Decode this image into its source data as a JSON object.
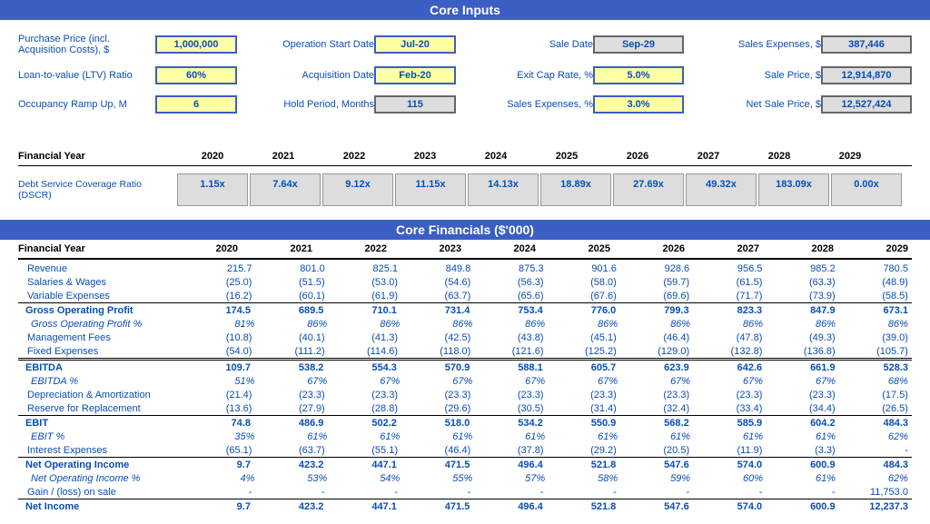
{
  "hdr1": "Core Inputs",
  "hdr2": "Core Financials ($'000)",
  "inputs": {
    "r1c1l": "Purchase Price (incl. Acquisition Costs), $",
    "r1c1v": "1,000,000",
    "r1c2l": "Operation Start Date",
    "r1c2v": "Jul-20",
    "r1c3l": "Sale Date",
    "r1c3v": "Sep-29",
    "r1c4l": "Sales Expenses, $",
    "r1c4v": "387,446",
    "r2c1l": "Loan-to-value (LTV) Ratio",
    "r2c1v": "60%",
    "r2c2l": "Acquisition Date",
    "r2c2v": "Feb-20",
    "r2c3l": "Exit Cap Rate, %",
    "r2c3v": "5.0%",
    "r2c4l": "Sale Price, $",
    "r2c4v": "12,914,870",
    "r3c1l": "Occupancy Ramp Up, M",
    "r3c1v": "6",
    "r3c2l": "Hold Period, Months",
    "r3c2v": "115",
    "r3c3l": "Sales Expenses, %",
    "r3c3v": "3.0%",
    "r3c4l": "Net Sale Price, $",
    "r3c4v": "12,527,424"
  },
  "fy_label": "Financial Year",
  "dscr_label": "Debt Service Coverage Ratio (DSCR)",
  "years": [
    "2020",
    "2021",
    "2022",
    "2023",
    "2024",
    "2025",
    "2026",
    "2027",
    "2028",
    "2029"
  ],
  "dscr": [
    "1.15x",
    "7.64x",
    "9.12x",
    "11.15x",
    "14.13x",
    "18.89x",
    "27.69x",
    "49.32x",
    "183.09x",
    "0.00x"
  ],
  "chart_data": {
    "type": "table",
    "title": "Core Financials ($'000)",
    "categories": [
      "2020",
      "2021",
      "2022",
      "2023",
      "2024",
      "2025",
      "2026",
      "2027",
      "2028",
      "2029"
    ],
    "series": [
      {
        "name": "Revenue",
        "values": [
          215.7,
          801.0,
          825.1,
          849.8,
          875.3,
          901.6,
          928.6,
          956.5,
          985.2,
          780.5
        ]
      },
      {
        "name": "Salaries & Wages",
        "values": [
          -25.0,
          -51.5,
          -53.0,
          -54.6,
          -56.3,
          -58.0,
          -59.7,
          -61.5,
          -63.3,
          -48.9
        ]
      },
      {
        "name": "Variable Expenses",
        "values": [
          -16.2,
          -60.1,
          -61.9,
          -63.7,
          -65.6,
          -67.6,
          -69.6,
          -71.7,
          -73.9,
          -58.5
        ]
      },
      {
        "name": "Gross Operating Profit",
        "values": [
          174.5,
          689.5,
          710.1,
          731.4,
          753.4,
          776.0,
          799.3,
          823.3,
          847.9,
          673.1
        ]
      },
      {
        "name": "Gross Operating Profit %",
        "values": [
          81,
          86,
          86,
          86,
          86,
          86,
          86,
          86,
          86,
          86
        ]
      },
      {
        "name": "Management Fees",
        "values": [
          -10.8,
          -40.1,
          -41.3,
          -42.5,
          -43.8,
          -45.1,
          -46.4,
          -47.8,
          -49.3,
          -39.0
        ]
      },
      {
        "name": "Fixed Expenses",
        "values": [
          -54.0,
          -111.2,
          -114.6,
          -118.0,
          -121.6,
          -125.2,
          -129.0,
          -132.8,
          -136.8,
          -105.7
        ]
      },
      {
        "name": "EBITDA",
        "values": [
          109.7,
          538.2,
          554.3,
          570.9,
          588.1,
          605.7,
          623.9,
          642.6,
          661.9,
          528.3
        ]
      },
      {
        "name": "EBITDA %",
        "values": [
          51,
          67,
          67,
          67,
          67,
          67,
          67,
          67,
          67,
          68
        ]
      },
      {
        "name": "Depreciation & Amortization",
        "values": [
          -21.4,
          -23.3,
          -23.3,
          -23.3,
          -23.3,
          -23.3,
          -23.3,
          -23.3,
          -23.3,
          -17.5
        ]
      },
      {
        "name": "Reserve for Replacement",
        "values": [
          -13.6,
          -27.9,
          -28.8,
          -29.6,
          -30.5,
          -31.4,
          -32.4,
          -33.4,
          -34.4,
          -26.5
        ]
      },
      {
        "name": "EBIT",
        "values": [
          74.8,
          486.9,
          502.2,
          518.0,
          534.2,
          550.9,
          568.2,
          585.9,
          604.2,
          484.3
        ]
      },
      {
        "name": "EBIT %",
        "values": [
          35,
          61,
          61,
          61,
          61,
          61,
          61,
          61,
          61,
          62
        ]
      },
      {
        "name": "Interest Expenses",
        "values": [
          -65.1,
          -63.7,
          -55.1,
          -46.4,
          -37.8,
          -29.2,
          -20.5,
          -11.9,
          -3.3,
          0
        ]
      },
      {
        "name": "Net Operating Income",
        "values": [
          9.7,
          423.2,
          447.1,
          471.5,
          496.4,
          521.8,
          547.6,
          574.0,
          600.9,
          484.3
        ]
      },
      {
        "name": "Net Operating Income %",
        "values": [
          4,
          53,
          54,
          55,
          57,
          58,
          59,
          60,
          61,
          62
        ]
      },
      {
        "name": "Gain / (loss) on sale",
        "values": [
          0,
          0,
          0,
          0,
          0,
          0,
          0,
          0,
          0,
          11753.0
        ]
      },
      {
        "name": "Net Income",
        "values": [
          9.7,
          423.2,
          447.1,
          471.5,
          496.4,
          521.8,
          547.6,
          574.0,
          600.9,
          12237.3
        ]
      }
    ]
  },
  "fin": {
    "revenue": {
      "l": "Revenue",
      "v": [
        "215.7",
        "801.0",
        "825.1",
        "849.8",
        "875.3",
        "901.6",
        "928.6",
        "956.5",
        "985.2",
        "780.5"
      ]
    },
    "salaries": {
      "l": "Salaries & Wages",
      "v": [
        "(25.0)",
        "(51.5)",
        "(53.0)",
        "(54.6)",
        "(56.3)",
        "(58.0)",
        "(59.7)",
        "(61.5)",
        "(63.3)",
        "(48.9)"
      ]
    },
    "varexp": {
      "l": "Variable Expenses",
      "v": [
        "(16.2)",
        "(60.1)",
        "(61.9)",
        "(63.7)",
        "(65.6)",
        "(67.6)",
        "(69.6)",
        "(71.7)",
        "(73.9)",
        "(58.5)"
      ]
    },
    "gop": {
      "l": "Gross Operating Profit",
      "v": [
        "174.5",
        "689.5",
        "710.1",
        "731.4",
        "753.4",
        "776.0",
        "799.3",
        "823.3",
        "847.9",
        "673.1"
      ]
    },
    "gopp": {
      "l": "Gross Operating Profit %",
      "v": [
        "81%",
        "86%",
        "86%",
        "86%",
        "86%",
        "86%",
        "86%",
        "86%",
        "86%",
        "86%"
      ]
    },
    "mgmt": {
      "l": "Management Fees",
      "v": [
        "(10.8)",
        "(40.1)",
        "(41.3)",
        "(42.5)",
        "(43.8)",
        "(45.1)",
        "(46.4)",
        "(47.8)",
        "(49.3)",
        "(39.0)"
      ]
    },
    "fixed": {
      "l": "Fixed Expenses",
      "v": [
        "(54.0)",
        "(111.2)",
        "(114.6)",
        "(118.0)",
        "(121.6)",
        "(125.2)",
        "(129.0)",
        "(132.8)",
        "(136.8)",
        "(105.7)"
      ]
    },
    "ebitda": {
      "l": "EBITDA",
      "v": [
        "109.7",
        "538.2",
        "554.3",
        "570.9",
        "588.1",
        "605.7",
        "623.9",
        "642.6",
        "661.9",
        "528.3"
      ]
    },
    "ebitdap": {
      "l": "EBITDA %",
      "v": [
        "51%",
        "67%",
        "67%",
        "67%",
        "67%",
        "67%",
        "67%",
        "67%",
        "67%",
        "68%"
      ]
    },
    "da": {
      "l": "Depreciation & Amortization",
      "v": [
        "(21.4)",
        "(23.3)",
        "(23.3)",
        "(23.3)",
        "(23.3)",
        "(23.3)",
        "(23.3)",
        "(23.3)",
        "(23.3)",
        "(17.5)"
      ]
    },
    "reserve": {
      "l": "Reserve for Replacement",
      "v": [
        "(13.6)",
        "(27.9)",
        "(28.8)",
        "(29.6)",
        "(30.5)",
        "(31.4)",
        "(32.4)",
        "(33.4)",
        "(34.4)",
        "(26.5)"
      ]
    },
    "ebit": {
      "l": "EBIT",
      "v": [
        "74.8",
        "486.9",
        "502.2",
        "518.0",
        "534.2",
        "550.9",
        "568.2",
        "585.9",
        "604.2",
        "484.3"
      ]
    },
    "ebitp": {
      "l": "EBIT %",
      "v": [
        "35%",
        "61%",
        "61%",
        "61%",
        "61%",
        "61%",
        "61%",
        "61%",
        "61%",
        "62%"
      ]
    },
    "intexp": {
      "l": "Interest Expenses",
      "v": [
        "(65.1)",
        "(63.7)",
        "(55.1)",
        "(46.4)",
        "(37.8)",
        "(29.2)",
        "(20.5)",
        "(11.9)",
        "(3.3)",
        "-"
      ]
    },
    "noi": {
      "l": "Net Operating Income",
      "v": [
        "9.7",
        "423.2",
        "447.1",
        "471.5",
        "496.4",
        "521.8",
        "547.6",
        "574.0",
        "600.9",
        "484.3"
      ]
    },
    "noip": {
      "l": "Net Operating Income %",
      "v": [
        "4%",
        "53%",
        "54%",
        "55%",
        "57%",
        "58%",
        "59%",
        "60%",
        "61%",
        "62%"
      ]
    },
    "gain": {
      "l": "Gain / (loss) on sale",
      "v": [
        "-",
        "-",
        "-",
        "-",
        "-",
        "-",
        "-",
        "-",
        "-",
        "11,753.0"
      ]
    },
    "ni": {
      "l": "Net Income",
      "v": [
        "9.7",
        "423.2",
        "447.1",
        "471.5",
        "496.4",
        "521.8",
        "547.6",
        "574.0",
        "600.9",
        "12,237.3"
      ]
    }
  }
}
